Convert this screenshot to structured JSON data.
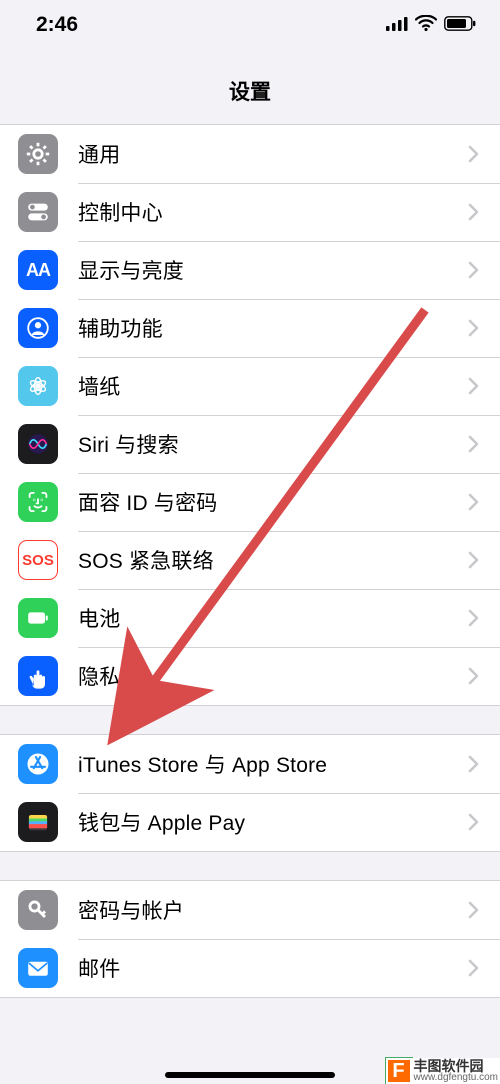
{
  "status": {
    "time": "2:46"
  },
  "header": {
    "title": "设置"
  },
  "groups": [
    {
      "rows": [
        {
          "key": "general",
          "label": "通用",
          "icon": "gear",
          "bg": "#8e8e93",
          "fg": "#fff"
        },
        {
          "key": "control-center",
          "label": "控制中心",
          "icon": "toggles",
          "bg": "#8e8e93",
          "fg": "#fff"
        },
        {
          "key": "display",
          "label": "显示与亮度",
          "icon": "AA",
          "bg": "#0a60ff",
          "fg": "#fff"
        },
        {
          "key": "accessibility",
          "label": "辅助功能",
          "icon": "person",
          "bg": "#0a60ff",
          "fg": "#fff"
        },
        {
          "key": "wallpaper",
          "label": "墙纸",
          "icon": "flower",
          "bg": "#54c7ec",
          "fg": "#fff"
        },
        {
          "key": "siri",
          "label": "Siri 与搜索",
          "icon": "siri",
          "bg": "#1c1c1e",
          "fg": "#fff"
        },
        {
          "key": "faceid",
          "label": "面容 ID 与密码",
          "icon": "faceid",
          "bg": "#30d158",
          "fg": "#fff"
        },
        {
          "key": "sos",
          "label": "SOS 紧急联络",
          "icon": "SOS",
          "bg": "#ffffff",
          "fg": "#ff3b30"
        },
        {
          "key": "battery",
          "label": "电池",
          "icon": "battery",
          "bg": "#30d158",
          "fg": "#fff"
        },
        {
          "key": "privacy",
          "label": "隐私",
          "icon": "hand",
          "bg": "#0a60ff",
          "fg": "#fff"
        }
      ]
    },
    {
      "rows": [
        {
          "key": "itunes",
          "label": "iTunes Store 与 App Store",
          "icon": "appstore",
          "bg": "#1e90ff",
          "fg": "#fff"
        },
        {
          "key": "wallet",
          "label": "钱包与 Apple Pay",
          "icon": "wallet",
          "bg": "#1c1c1e",
          "fg": "#fff"
        }
      ]
    },
    {
      "rows": [
        {
          "key": "passwords",
          "label": "密码与帐户",
          "icon": "key",
          "bg": "#8e8e93",
          "fg": "#fff"
        },
        {
          "key": "mail",
          "label": "邮件",
          "icon": "mail",
          "bg": "#1e90ff",
          "fg": "#fff"
        }
      ]
    }
  ],
  "watermark": {
    "name": "丰图软件园",
    "url": "www.dgfengtu.com"
  }
}
